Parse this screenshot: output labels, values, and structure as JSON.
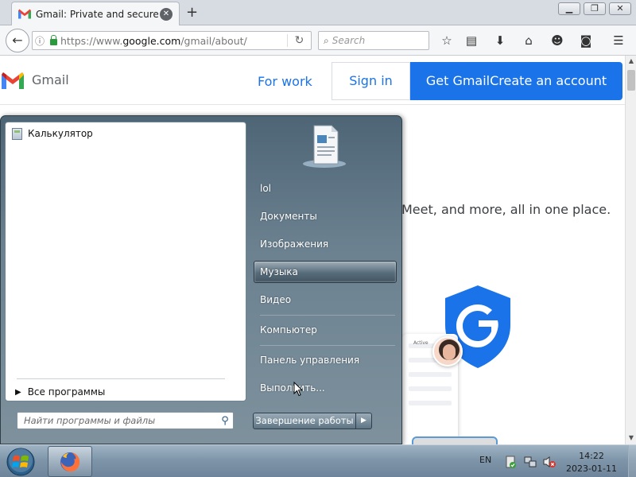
{
  "browser": {
    "tab_title": "Gmail: Private and secure e...",
    "new_tab_icon": "plus-icon",
    "url_prefix": "https://www.",
    "url_domain": "google.com",
    "url_path": "/gmail/about/",
    "search_placeholder": "Search",
    "window_buttons": [
      "minimize",
      "maximize",
      "close"
    ]
  },
  "gmail": {
    "brand": "Gmail",
    "nav": {
      "for_work": "For work",
      "sign_in": "Sign in",
      "cta": "Get GmailCreate an account"
    },
    "tagline": "Meet, and more, all in one place.",
    "card_label": "Active",
    "colors": {
      "blue": "#1a73e8",
      "red": "#ea4335"
    }
  },
  "start_menu": {
    "programs": [
      "Калькулятор"
    ],
    "all_programs": "Все программы",
    "search_placeholder": "Найти программы и файлы",
    "right_items": [
      "lol",
      "Документы",
      "Изображения",
      "Музыка",
      "Видео",
      "Компьютер",
      "Панель управления",
      "Выполнить..."
    ],
    "hovered_item": "Музыка",
    "shutdown": "Завершение работы"
  },
  "taskbar": {
    "language": "EN",
    "time": "14:22",
    "date": "2023-01-11",
    "pinned": [
      "firefox-icon"
    ]
  }
}
